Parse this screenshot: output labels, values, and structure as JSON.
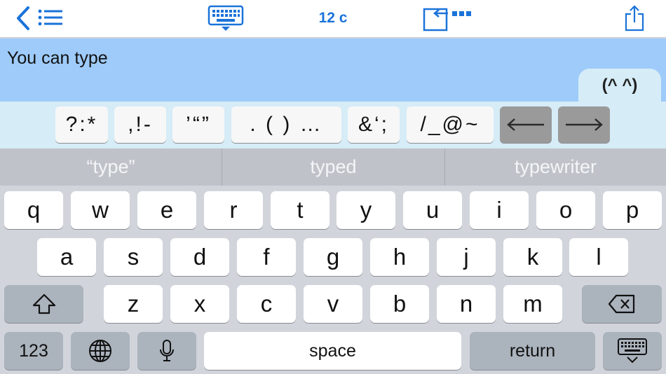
{
  "toolbar": {
    "back_icon": "chevron-left-icon",
    "list_icon": "list-icon",
    "keyboard_icon": "keyboard-dismiss-icon",
    "char_count": "12 c",
    "insert_icon": "insert-arrow-icon",
    "share_icon": "share-icon",
    "accent_color": "#1a73d9"
  },
  "editor": {
    "text": "You can type",
    "emoticon_tab": "(^ ^)",
    "background_color": "#9ecbfa"
  },
  "symbol_row": {
    "keys": [
      "?:*",
      ",!-",
      "’“”",
      ". ( ) …",
      "&‘;",
      "/_@~",
      "←",
      "→"
    ]
  },
  "suggestions": [
    "“type”",
    "typed",
    "typewriter"
  ],
  "keyboard": {
    "row1": [
      "q",
      "w",
      "e",
      "r",
      "t",
      "y",
      "u",
      "i",
      "o",
      "p"
    ],
    "row2": [
      "a",
      "s",
      "d",
      "f",
      "g",
      "h",
      "j",
      "k",
      "l"
    ],
    "row3": [
      "z",
      "x",
      "c",
      "v",
      "b",
      "n",
      "m"
    ],
    "shift_icon": "shift-icon",
    "backspace_icon": "backspace-icon",
    "numbers_label": "123",
    "globe_icon": "globe-icon",
    "mic_icon": "microphone-icon",
    "space_label": "space",
    "return_label": "return",
    "dismiss_icon": "keyboard-dismiss-icon"
  }
}
